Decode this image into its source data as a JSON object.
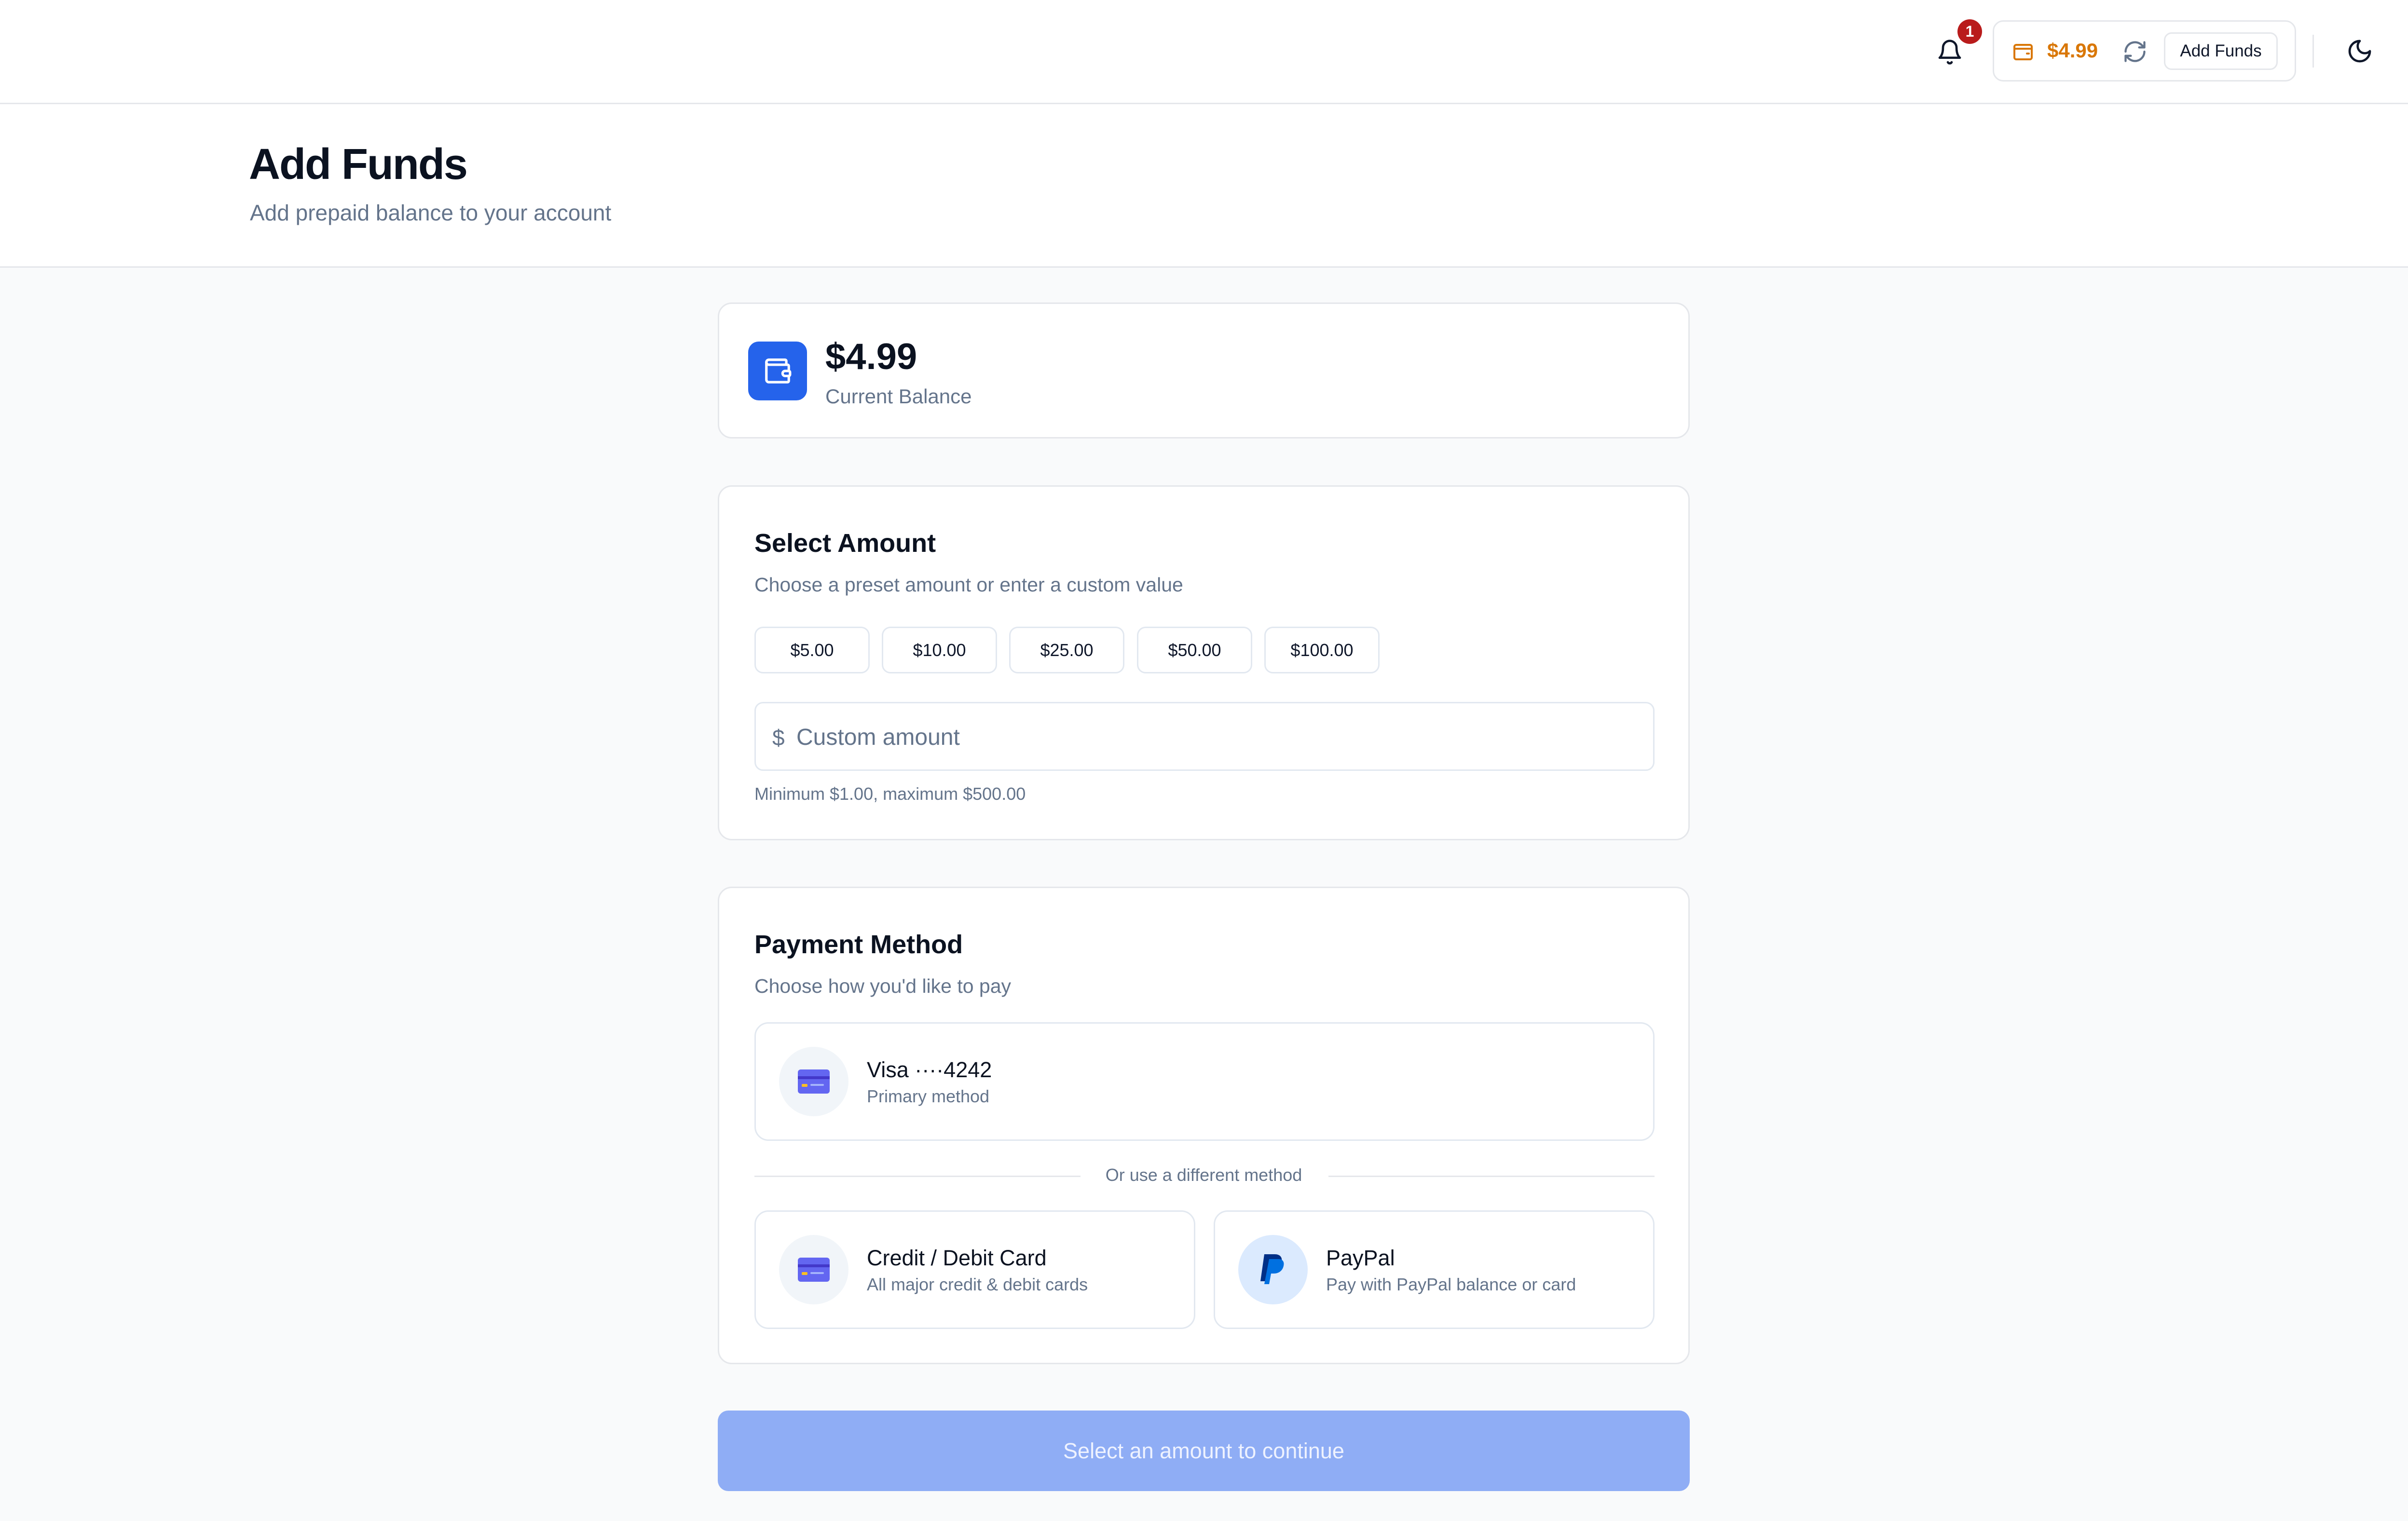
{
  "topbar": {
    "notifications_count": "1",
    "balance": "$4.99",
    "add_funds_label": "Add Funds",
    "icons": [
      "bell-icon",
      "wallet-icon",
      "refresh-icon",
      "moon-icon"
    ],
    "colors": {
      "badge": "#b91c1c",
      "balance_text": "#d97706"
    }
  },
  "header": {
    "title": "Add Funds",
    "subtitle": "Add prepaid balance to your account"
  },
  "balance_card": {
    "amount": "$4.99",
    "label": "Current Balance",
    "icon": "wallet-icon",
    "accent": "#2563eb"
  },
  "amount_section": {
    "title": "Select Amount",
    "subtitle": "Choose a preset amount or enter a custom value",
    "presets": [
      "$5.00",
      "$10.00",
      "$25.00",
      "$50.00",
      "$100.00"
    ],
    "currency_symbol": "$",
    "custom_placeholder": "Custom amount",
    "custom_value": "",
    "hint": "Minimum $1.00, maximum $500.00"
  },
  "payment_section": {
    "title": "Payment Method",
    "subtitle": "Choose how you'd like to pay",
    "saved_method": {
      "title": "Visa ····4242",
      "subtitle": "Primary method",
      "icon": "credit-card-icon"
    },
    "divider": "Or use a different method",
    "methods": [
      {
        "title": "Credit / Debit Card",
        "subtitle": "All major credit & debit cards",
        "icon": "credit-card-icon"
      },
      {
        "title": "PayPal",
        "subtitle": "Pay with PayPal balance or card",
        "icon": "paypal-icon"
      }
    ]
  },
  "cta": {
    "label": "Select an amount to continue",
    "color": "#8fadf5"
  }
}
